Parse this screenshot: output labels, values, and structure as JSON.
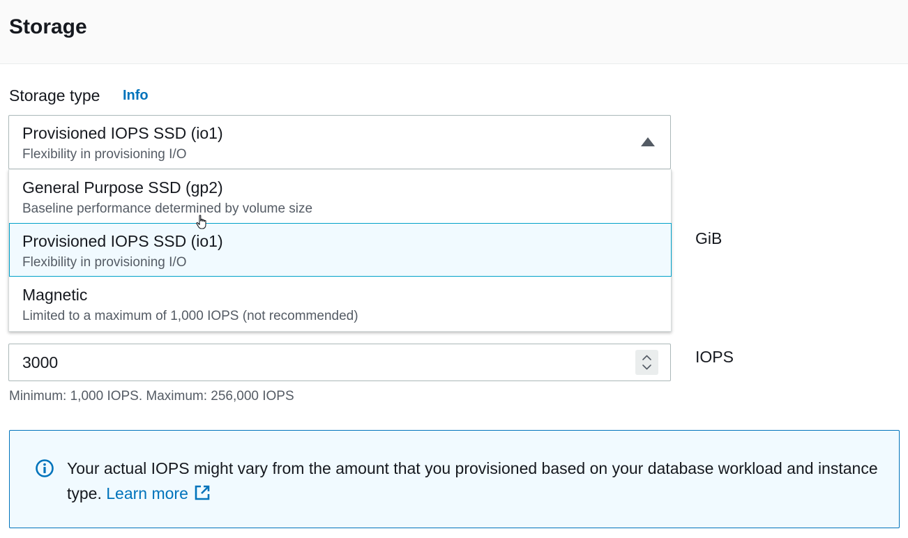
{
  "section": {
    "title": "Storage"
  },
  "storage_type": {
    "label": "Storage type",
    "info_link": "Info",
    "selected": {
      "title": "Provisioned IOPS SSD (io1)",
      "description": "Flexibility in provisioning I/O"
    },
    "options": [
      {
        "title": "General Purpose SSD (gp2)",
        "description": "Baseline performance determined by volume size"
      },
      {
        "title": "Provisioned IOPS SSD (io1)",
        "description": "Flexibility in provisioning I/O"
      },
      {
        "title": "Magnetic",
        "description": "Limited to a maximum of 1,000 IOPS (not recommended)"
      }
    ]
  },
  "allocated_storage": {
    "unit": "GiB"
  },
  "provisioned_iops": {
    "value": "3000",
    "unit": "IOPS",
    "constraint": "Minimum: 1,000 IOPS. Maximum: 256,000 IOPS"
  },
  "info_alert": {
    "text": "Your actual IOPS might vary from the amount that you provisioned based on your database workload and instance type.",
    "link": "Learn more"
  },
  "icons": {
    "dropdown_caret": "caret-up-icon",
    "spinner": "stepper-icon",
    "alert": "info-circle-icon",
    "external": "external-link-icon",
    "cursor": "hand-pointer-icon"
  },
  "colors": {
    "link": "#0073bb",
    "selected_option_bg": "#f1faff",
    "selected_option_border": "#00a1c9",
    "alert_bg": "#f1faff",
    "alert_border": "#0073bb"
  }
}
